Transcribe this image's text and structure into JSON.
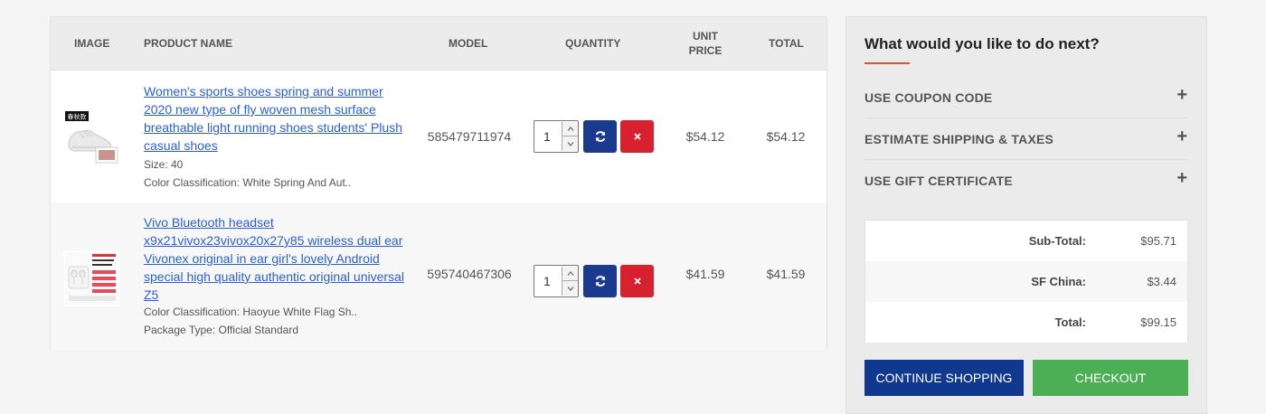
{
  "table": {
    "headers": {
      "image": "IMAGE",
      "product_name": "PRODUCT NAME",
      "model": "MODEL",
      "quantity": "QUANTITY",
      "unit_price": "UNIT PRICE",
      "total": "TOTAL"
    },
    "rows": [
      {
        "name": "Women's sports shoes spring and summer 2020 new type of fly woven mesh surface breathable light running shoes students' Plush casual shoes",
        "options": [
          "Size: 40",
          "Color Classification: White Spring And Aut.."
        ],
        "image_badge": "春秋款",
        "model": "585479711974",
        "quantity": "1",
        "unit_price": "$54.12",
        "total": "$54.12"
      },
      {
        "name": "Vivo Bluetooth headset x9x21vivox23vivox20x27y85 wireless dual ear Vivonex original in ear girl's lovely Android special high quality authentic original universal Z5",
        "options": [
          "Color Classification: Haoyue White Flag Sh..",
          "Package Type: Official Standard"
        ],
        "image_badge": "",
        "model": "595740467306",
        "quantity": "1",
        "unit_price": "$41.59",
        "total": "$41.59"
      }
    ]
  },
  "sidebar": {
    "title": "What would you like to do next?",
    "accordion": [
      {
        "label": "USE COUPON CODE"
      },
      {
        "label": "ESTIMATE SHIPPING & TAXES"
      },
      {
        "label": "USE GIFT CERTIFICATE"
      }
    ],
    "totals": [
      {
        "label": "Sub-Total:",
        "value": "$95.71"
      },
      {
        "label": "SF China:",
        "value": "$3.44"
      },
      {
        "label": "Total:",
        "value": "$99.15"
      }
    ],
    "continue_label": "CONTINUE SHOPPING",
    "checkout_label": "CHECKOUT"
  },
  "icons": {
    "refresh": "refresh-icon",
    "remove": "close-icon",
    "expand": "plus-icon",
    "spin_up": "chevron-up-icon",
    "spin_down": "chevron-down-icon"
  },
  "colors": {
    "link": "#2b5fd9",
    "refresh_button": "#1a3a8f",
    "remove_button": "#d8212e",
    "continue_button": "#11388f",
    "checkout_button": "#4caf56",
    "accent_underline": "#e0542b"
  }
}
